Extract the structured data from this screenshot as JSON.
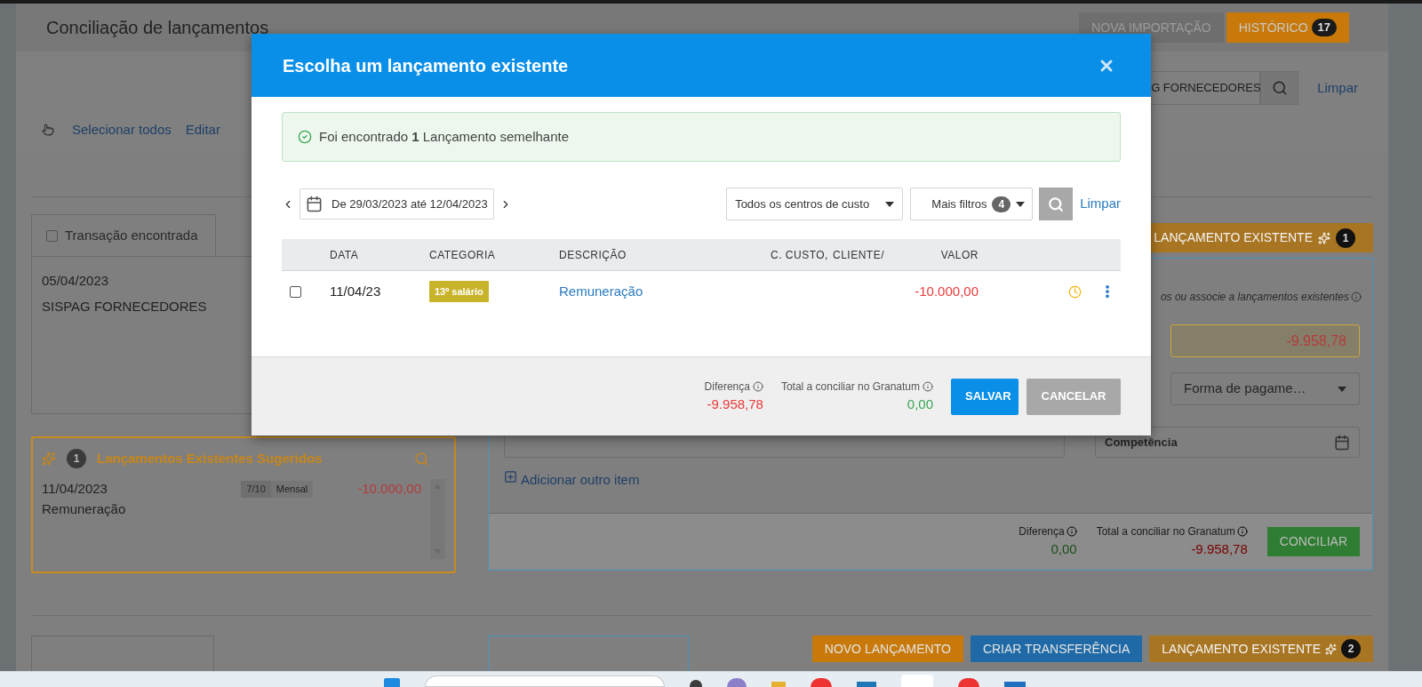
{
  "page": {
    "title": "Conciliação de lançamentos"
  },
  "header_buttons": [
    {
      "label": "NOVA IMPORTAÇÃO",
      "kind": "plain"
    },
    {
      "label": "HISTÓRICO",
      "kind": "accent",
      "count": "17"
    }
  ],
  "search": {
    "value": "G FORNECEDORES",
    "clear": "Limpar"
  },
  "toolbar": [
    "Selecionar todos",
    "Editar"
  ],
  "transaction": {
    "checked": false,
    "tab": "Transação encontrada",
    "date": "05/04/2023",
    "description": "SISPAG FORNECEDORES"
  },
  "suggested": {
    "count": "1",
    "title": "Lançamentos Existentes Sugeridos",
    "items": [
      {
        "date": "11/04/2023",
        "description": "Remuneração",
        "installment": "7/10",
        "frequency": "Mensal",
        "amount": "-10.000,00"
      }
    ]
  },
  "existing_bar": {
    "label": "LANÇAMENTO EXISTENTE",
    "count": "1"
  },
  "form": {
    "hint": "os ou associe a lançamentos existentes",
    "amount": "-9.958,78",
    "payment": "Forma de pagame…",
    "date_field": "Competência",
    "add_item": "Adicionar outro item",
    "difference_label": "Diferença",
    "difference": "0,00",
    "total_label": "Total a conciliar no Granatum",
    "total": "-9.958,78",
    "submit": "CONCILIAR"
  },
  "bottom_actions": [
    {
      "label": "NOVO LANÇAMENTO",
      "kind": "orange"
    },
    {
      "label": "CRIAR TRANSFERÊNCIA",
      "kind": "blue"
    },
    {
      "label": "LANÇAMENTO EXISTENTE",
      "kind": "existing",
      "count": "2"
    }
  ],
  "modal": {
    "title": "Escolha um lançamento existente",
    "alert": "Foi encontrado **1** Lançamento semelhante",
    "date_range": "De 29/03/2023 até 12/04/2023",
    "cost_center": "Todos os centros de custo",
    "more_filters": {
      "label": "Mais filtros",
      "count": "4"
    },
    "clear": "Limpar",
    "columns": [
      "DATA",
      "CATEGORIA",
      "DESCRIÇÃO",
      "C. CUSTO,",
      "CLIENTE/",
      "VALOR"
    ],
    "rows": [
      {
        "checked": false,
        "date": "11/04/23",
        "category": "13º salário",
        "description": "Remuneração",
        "value": "-10.000,00"
      }
    ],
    "difference_label": "Diferença",
    "difference": "-9.958,78",
    "total_label": "Total a conciliar no Granatum",
    "total": "0,00",
    "buttons": [
      {
        "label": "SALVAR",
        "kind": "primary"
      },
      {
        "label": "CANCELAR",
        "kind": "secondary"
      }
    ]
  }
}
